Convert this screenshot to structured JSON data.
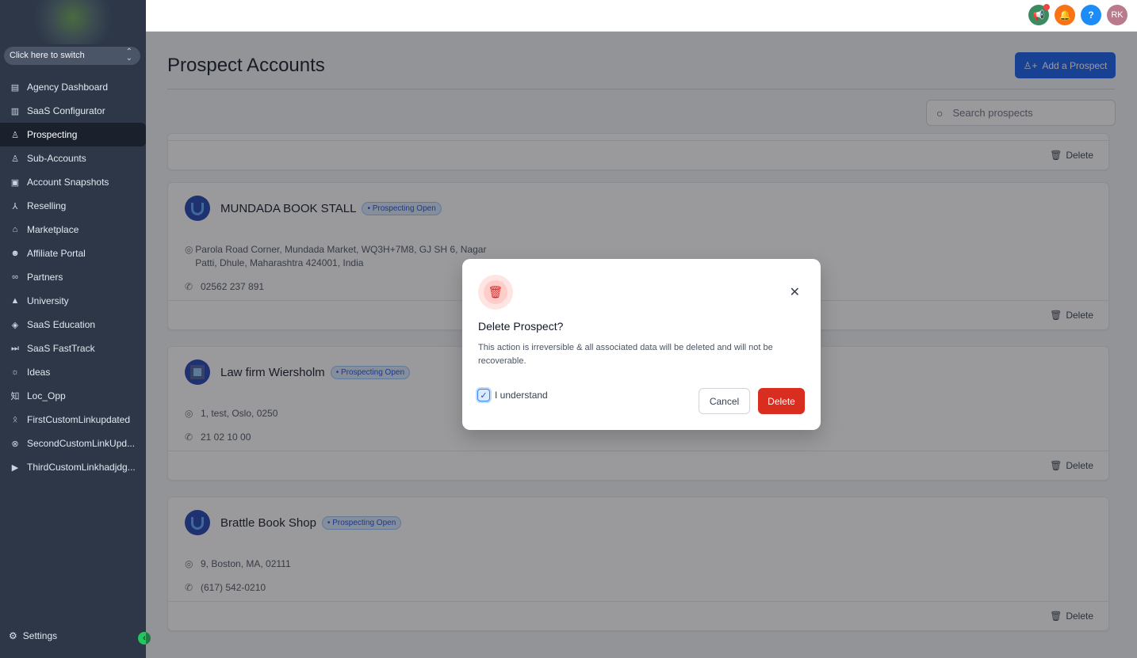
{
  "sidebar": {
    "switcher_label": "Click here to switch",
    "items": [
      {
        "label": "Agency Dashboard",
        "icon": "dashboard-icon",
        "glyph": "▤"
      },
      {
        "label": "SaaS Configurator",
        "icon": "bar-chart-icon",
        "glyph": "▥"
      },
      {
        "label": "Prospecting",
        "icon": "users-search-icon",
        "glyph": "♙",
        "active": true
      },
      {
        "label": "Sub-Accounts",
        "icon": "user-icon",
        "glyph": "♙"
      },
      {
        "label": "Account Snapshots",
        "icon": "snapshot-icon",
        "glyph": "▣"
      },
      {
        "label": "Reselling",
        "icon": "network-icon",
        "glyph": "⅄"
      },
      {
        "label": "Marketplace",
        "icon": "bag-icon",
        "glyph": "⌂"
      },
      {
        "label": "Affiliate Portal",
        "icon": "group-icon",
        "glyph": "☻"
      },
      {
        "label": "Partners",
        "icon": "handshake-icon",
        "glyph": "∞"
      },
      {
        "label": "University",
        "icon": "graduation-cap-icon",
        "glyph": "▲"
      },
      {
        "label": "SaaS Education",
        "icon": "box-icon",
        "glyph": "◈"
      },
      {
        "label": "SaaS FastTrack",
        "icon": "fast-forward-icon",
        "glyph": "⏭"
      },
      {
        "label": "Ideas",
        "icon": "lightbulb-icon",
        "glyph": "☼"
      },
      {
        "label": "Loc_Opp",
        "icon": "zhihu-icon",
        "glyph": "知"
      },
      {
        "label": "FirstCustomLinkupdated",
        "icon": "walking-icon",
        "glyph": "ᛟ"
      },
      {
        "label": "SecondCustomLinkUpd...",
        "icon": "xbox-icon",
        "glyph": "⊗"
      },
      {
        "label": "ThirdCustomLinkhadjdg...",
        "icon": "youtube-icon",
        "glyph": "▶"
      }
    ],
    "settings_label": "Settings"
  },
  "topbar": {
    "avatar_initials": "RK",
    "help_glyph": "?",
    "colors": {
      "announce": "#3c8a5f",
      "bell": "#f97316",
      "help": "#1d8cf8",
      "avatar": "#b97b8b"
    }
  },
  "main": {
    "title": "Prospect Accounts",
    "add_button": "Add a Prospect",
    "search_placeholder": "Search prospects",
    "delete_label": "Delete",
    "cards": [
      {
        "name": "MUNDADA BOOK STALL",
        "status": "• Prospecting Open",
        "address": "Parola Road Corner, Mundada Market, WQ3H+7M8, GJ SH 6, Nagar Patti, Dhule, Maharashtra 424001, India",
        "phone": "02562 237 891"
      },
      {
        "name": "Law firm Wiersholm",
        "status": "• Prospecting Open",
        "address": "1, test, Oslo, 0250",
        "phone": "21 02 10 00"
      },
      {
        "name": "Brattle Book Shop",
        "status": "• Prospecting Open",
        "address": "9, Boston, MA, 02111",
        "phone": "(617) 542-0210"
      }
    ]
  },
  "modal": {
    "title": "Delete Prospect?",
    "message": "This action is irreversible & all associated data will be deleted and will not be recoverable.",
    "checkbox_label": "I understand",
    "checkbox_checked": true,
    "cancel_label": "Cancel",
    "delete_label": "Delete"
  }
}
